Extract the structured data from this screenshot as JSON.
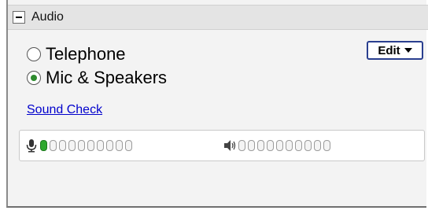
{
  "header": {
    "title": "Audio",
    "collapse_icon": "minus-icon"
  },
  "audio_options": [
    {
      "label": "Telephone",
      "selected": false
    },
    {
      "label": "Mic & Speakers",
      "selected": true
    }
  ],
  "edit_button": {
    "label": "Edit",
    "icon": "caret-down-icon"
  },
  "sound_check": {
    "label": "Sound Check"
  },
  "meters": {
    "microphone": {
      "icon": "microphone-icon",
      "segments": 10,
      "active_segments": 1
    },
    "speaker": {
      "icon": "speaker-icon",
      "segments": 10,
      "active_segments": 0
    }
  },
  "colors": {
    "accent_green": "#2fa82f",
    "link_blue": "#0000cc",
    "edit_border": "#2a3f8f"
  }
}
